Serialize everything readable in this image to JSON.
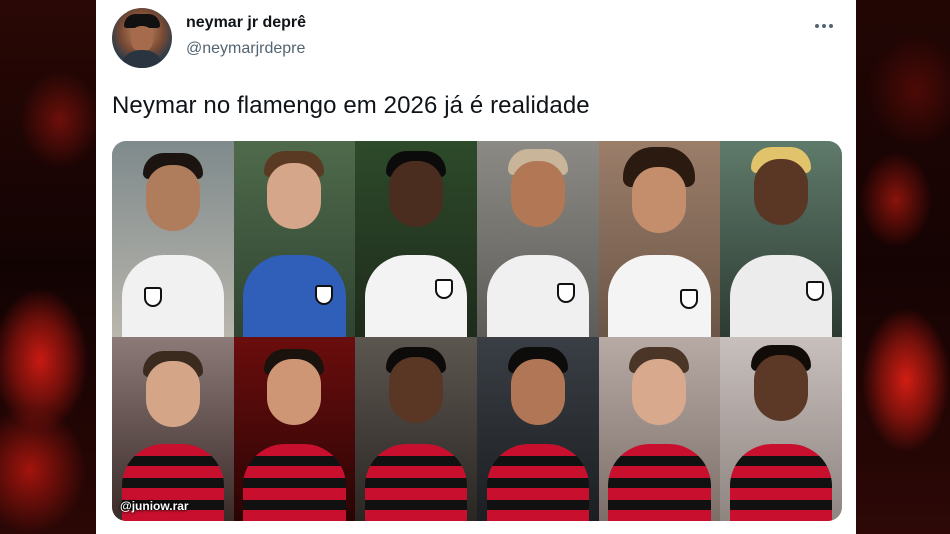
{
  "tweet": {
    "display_name": "neymar jr deprê",
    "handle": "@neymarjrdepre",
    "text": "Neymar no flamengo em 2026 já é realidade",
    "more_icon": "more-horizontal-icon"
  },
  "image": {
    "watermark": "@juniow.rar",
    "rows": [
      {
        "team": "Santos",
        "players": 6
      },
      {
        "team": "Flamengo",
        "players": 6
      }
    ]
  },
  "colors": {
    "text_primary": "#0f1419",
    "text_secondary": "#536471",
    "santos_white": "#f2f2f2",
    "flamengo_red": "#c8102e",
    "flamengo_black": "#111111"
  }
}
